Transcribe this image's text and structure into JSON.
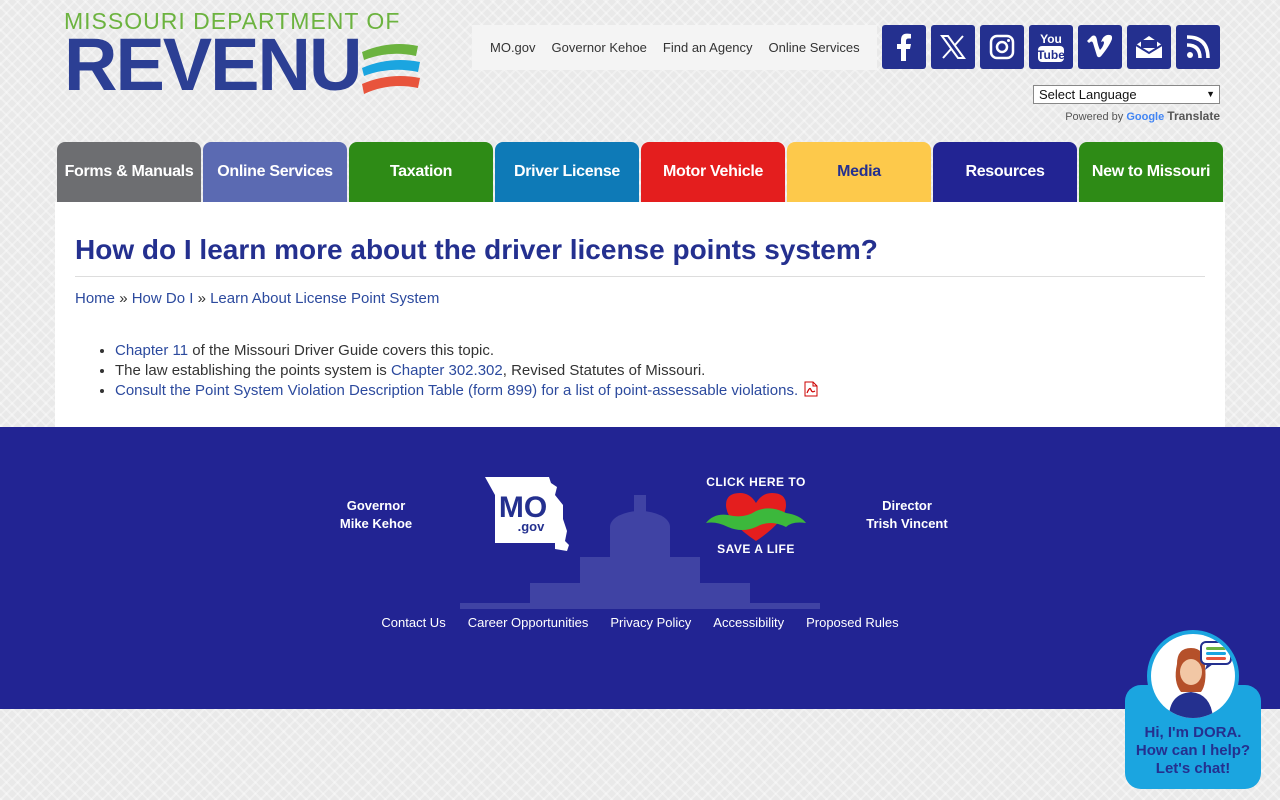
{
  "header": {
    "logo_top": "MISSOURI DEPARTMENT OF",
    "logo_main": "REVENU",
    "util_links": [
      "MO.gov",
      "Governor Kehoe",
      "Find an Agency",
      "Online Services"
    ],
    "social_icons": [
      "facebook-icon",
      "x-icon",
      "instagram-icon",
      "youtube-icon",
      "vimeo-icon",
      "email-icon",
      "rss-icon"
    ],
    "social_youtube_top": "You",
    "social_youtube_bottom": "Tube",
    "language_select": "Select Language",
    "powered_by": "Powered by",
    "powered_google": "Google",
    "powered_translate": "Translate"
  },
  "nav": {
    "tabs": [
      {
        "label": "Forms & Manuals",
        "color": "#6d6e71"
      },
      {
        "label": "Online Services",
        "color": "#5b6ab2"
      },
      {
        "label": "Taxation",
        "color": "#2e8b16"
      },
      {
        "label": "Driver License",
        "color": "#0e7ab7"
      },
      {
        "label": "Motor Vehicle",
        "color": "#e41e1e"
      },
      {
        "label": "Media",
        "color": "#fdc94b"
      },
      {
        "label": "Resources",
        "color": "#222493"
      },
      {
        "label": "New to Missouri",
        "color": "#2e8b16"
      }
    ]
  },
  "content": {
    "title": "How do I learn more about the driver license points system?",
    "breadcrumb": {
      "home": "Home",
      "sep": "»",
      "how_do_i": "How Do I",
      "current": "Learn About License Point System"
    },
    "bullets": {
      "b1_link": "Chapter 11",
      "b1_text": " of the Missouri Driver Guide covers this topic.",
      "b2_text_pre": "The law establishing the points system is ",
      "b2_link": "Chapter 302.302",
      "b2_text_post": ", Revised Statutes of Missouri.",
      "b3_link": "Consult the Point System Violation Description Table (form 899) for a list of point-assessable violations."
    }
  },
  "footer": {
    "governor_title": "Governor",
    "governor_name": "Mike Kehoe",
    "director_title": "Director",
    "director_name": "Trish Vincent",
    "mo_logo_text": "MO",
    "mo_logo_sub": ".gov",
    "save_life_top": "CLICK HERE TO",
    "save_life_bottom": "SAVE A LIFE",
    "links": [
      "Contact Us",
      "Career Opportunities",
      "Privacy Policy",
      "Accessibility",
      "Proposed Rules"
    ]
  },
  "chat": {
    "line1": "Hi, I'm DORA.",
    "line2": "How can I help?",
    "line3": "Let's chat!"
  },
  "colors": {
    "brand_blue": "#24308f",
    "link_blue": "#2c4a9e",
    "footer_bg": "#222493",
    "chat_bg": "#1ba5e0"
  }
}
